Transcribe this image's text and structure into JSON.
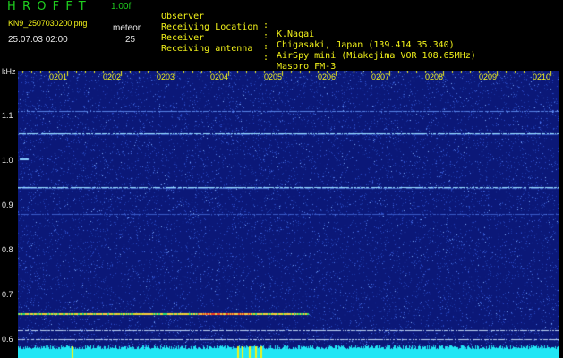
{
  "app": {
    "title": "HROFFT",
    "version": "1.00f",
    "filename": "KN9_2507030200.png",
    "mode": "meteor",
    "datetime": "25.07.03 02:00",
    "count": "25"
  },
  "info": [
    {
      "key": "Observer",
      "value": "K.Nagai"
    },
    {
      "key": "Receiving Location",
      "value": "Chigasaki, Japan (139.414 35.340)"
    },
    {
      "key": "Receiver",
      "value": "AirSpy mini (Miakejima VOR 108.65MHz)"
    },
    {
      "key": "Receiving antenna",
      "value": "Maspro FM-3"
    }
  ],
  "spectrogram": {
    "y_unit": "kHz",
    "y_ticks": [
      "1.1",
      "1.0",
      "0.9",
      "0.8",
      "0.7",
      "0.6"
    ],
    "x_ticks": [
      "0201",
      "0202",
      "0203",
      "0204",
      "0205",
      "0206",
      "0207",
      "0208",
      "0209",
      "0210"
    ],
    "colors": {
      "background": "#0b1878",
      "noise": "#2c4cc8",
      "carrier": "#9ae0ff",
      "baseline": "#21e6f5",
      "meteor": "#ffb020",
      "tick": "#f2f21a"
    }
  }
}
